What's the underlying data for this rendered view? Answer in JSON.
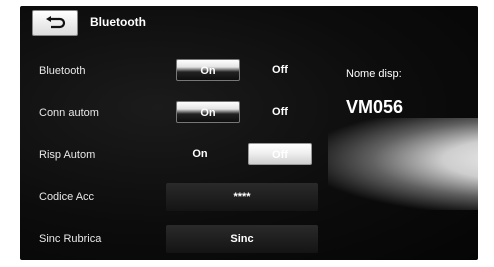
{
  "header": {
    "title": "Bluetooth",
    "back_icon": "back-arrow-icon"
  },
  "rows": {
    "bluetooth": {
      "label": "Bluetooth",
      "on": "On",
      "off": "Off",
      "selected": "On"
    },
    "conn_autom": {
      "label": "Conn autom",
      "on": "On",
      "off": "Off",
      "selected": "On"
    },
    "risp_autom": {
      "label": "Risp Autom",
      "on": "On",
      "off": "Off",
      "selected": "Off"
    },
    "codice_acc": {
      "label": "Codice Acc",
      "value": "****"
    },
    "sinc_rubrica": {
      "label": "Sinc Rubrica",
      "button": "Sinc"
    }
  },
  "device": {
    "name_label": "Nome disp:",
    "name_value": "VM056"
  }
}
